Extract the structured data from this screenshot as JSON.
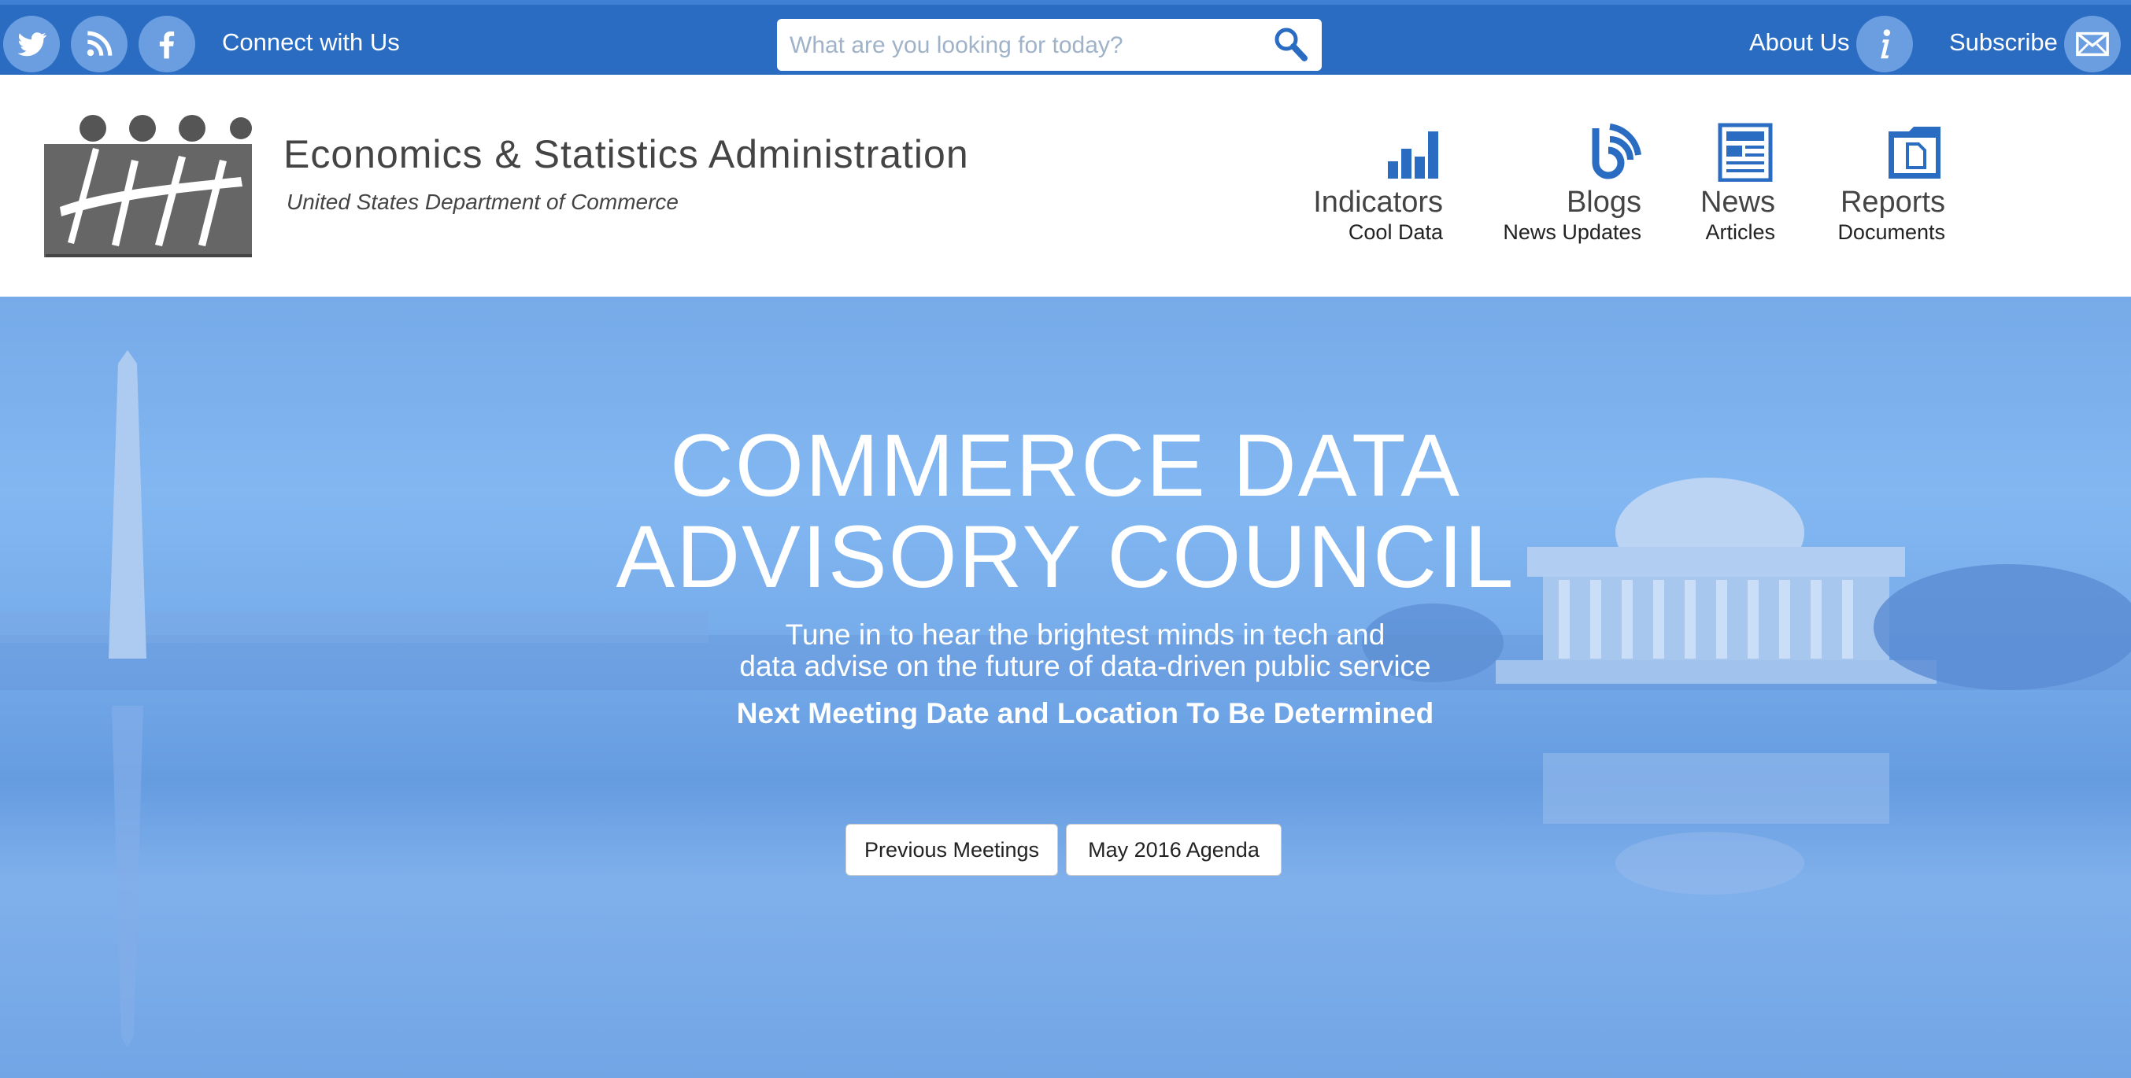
{
  "topbar": {
    "social": [
      {
        "name": "twitter-icon"
      },
      {
        "name": "rss-icon"
      },
      {
        "name": "facebook-icon"
      }
    ],
    "connect_label": "Connect with Us",
    "search_placeholder": "What are you looking for today?",
    "about_label": "About Us",
    "subscribe_label": "Subscribe"
  },
  "header": {
    "org_title": "Economics & Statistics Administration",
    "org_subtitle": "United States Department of Commerce",
    "nav": [
      {
        "label": "Indicators",
        "sub": "Cool Data",
        "icon": "bar-chart-icon"
      },
      {
        "label": "Blogs",
        "sub": "News Updates",
        "icon": "blog-icon"
      },
      {
        "label": "News",
        "sub": "Articles",
        "icon": "newspaper-icon"
      },
      {
        "label": "Reports",
        "sub": "Documents",
        "icon": "folder-icon"
      }
    ]
  },
  "hero": {
    "title_line1": "COMMERCE DATA",
    "title_line2": "ADVISORY COUNCIL",
    "subtitle_line1": "Tune in to hear the brightest minds in tech and",
    "subtitle_line2": "data advise on the future of data-driven public service",
    "next_meeting": "Next Meeting Date and Location To Be Determined",
    "buttons": [
      {
        "label": "Previous Meetings"
      },
      {
        "label": "May 2016 Agenda"
      }
    ]
  },
  "colors": {
    "topbar": "#2a6cc2",
    "icon_circle": "#6b9ee0",
    "nav_icon": "#2a6cc2",
    "hero": "#7fb0ea"
  }
}
